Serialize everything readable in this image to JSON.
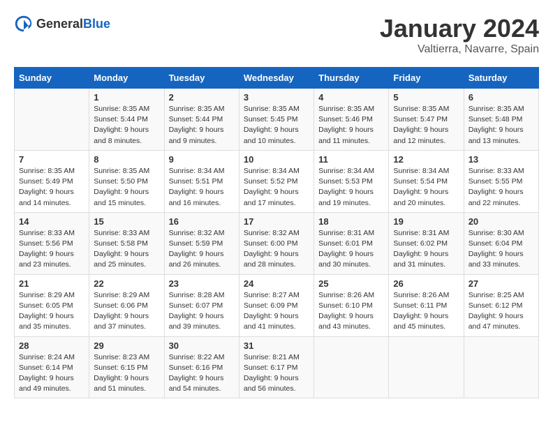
{
  "header": {
    "logo_general": "General",
    "logo_blue": "Blue",
    "month": "January 2024",
    "location": "Valtierra, Navarre, Spain"
  },
  "weekdays": [
    "Sunday",
    "Monday",
    "Tuesday",
    "Wednesday",
    "Thursday",
    "Friday",
    "Saturday"
  ],
  "weeks": [
    [
      {
        "day": "",
        "sunrise": "",
        "sunset": "",
        "daylight": ""
      },
      {
        "day": "1",
        "sunrise": "Sunrise: 8:35 AM",
        "sunset": "Sunset: 5:44 PM",
        "daylight": "Daylight: 9 hours and 8 minutes."
      },
      {
        "day": "2",
        "sunrise": "Sunrise: 8:35 AM",
        "sunset": "Sunset: 5:44 PM",
        "daylight": "Daylight: 9 hours and 9 minutes."
      },
      {
        "day": "3",
        "sunrise": "Sunrise: 8:35 AM",
        "sunset": "Sunset: 5:45 PM",
        "daylight": "Daylight: 9 hours and 10 minutes."
      },
      {
        "day": "4",
        "sunrise": "Sunrise: 8:35 AM",
        "sunset": "Sunset: 5:46 PM",
        "daylight": "Daylight: 9 hours and 11 minutes."
      },
      {
        "day": "5",
        "sunrise": "Sunrise: 8:35 AM",
        "sunset": "Sunset: 5:47 PM",
        "daylight": "Daylight: 9 hours and 12 minutes."
      },
      {
        "day": "6",
        "sunrise": "Sunrise: 8:35 AM",
        "sunset": "Sunset: 5:48 PM",
        "daylight": "Daylight: 9 hours and 13 minutes."
      }
    ],
    [
      {
        "day": "7",
        "sunrise": "Sunrise: 8:35 AM",
        "sunset": "Sunset: 5:49 PM",
        "daylight": "Daylight: 9 hours and 14 minutes."
      },
      {
        "day": "8",
        "sunrise": "Sunrise: 8:35 AM",
        "sunset": "Sunset: 5:50 PM",
        "daylight": "Daylight: 9 hours and 15 minutes."
      },
      {
        "day": "9",
        "sunrise": "Sunrise: 8:34 AM",
        "sunset": "Sunset: 5:51 PM",
        "daylight": "Daylight: 9 hours and 16 minutes."
      },
      {
        "day": "10",
        "sunrise": "Sunrise: 8:34 AM",
        "sunset": "Sunset: 5:52 PM",
        "daylight": "Daylight: 9 hours and 17 minutes."
      },
      {
        "day": "11",
        "sunrise": "Sunrise: 8:34 AM",
        "sunset": "Sunset: 5:53 PM",
        "daylight": "Daylight: 9 hours and 19 minutes."
      },
      {
        "day": "12",
        "sunrise": "Sunrise: 8:34 AM",
        "sunset": "Sunset: 5:54 PM",
        "daylight": "Daylight: 9 hours and 20 minutes."
      },
      {
        "day": "13",
        "sunrise": "Sunrise: 8:33 AM",
        "sunset": "Sunset: 5:55 PM",
        "daylight": "Daylight: 9 hours and 22 minutes."
      }
    ],
    [
      {
        "day": "14",
        "sunrise": "Sunrise: 8:33 AM",
        "sunset": "Sunset: 5:56 PM",
        "daylight": "Daylight: 9 hours and 23 minutes."
      },
      {
        "day": "15",
        "sunrise": "Sunrise: 8:33 AM",
        "sunset": "Sunset: 5:58 PM",
        "daylight": "Daylight: 9 hours and 25 minutes."
      },
      {
        "day": "16",
        "sunrise": "Sunrise: 8:32 AM",
        "sunset": "Sunset: 5:59 PM",
        "daylight": "Daylight: 9 hours and 26 minutes."
      },
      {
        "day": "17",
        "sunrise": "Sunrise: 8:32 AM",
        "sunset": "Sunset: 6:00 PM",
        "daylight": "Daylight: 9 hours and 28 minutes."
      },
      {
        "day": "18",
        "sunrise": "Sunrise: 8:31 AM",
        "sunset": "Sunset: 6:01 PM",
        "daylight": "Daylight: 9 hours and 30 minutes."
      },
      {
        "day": "19",
        "sunrise": "Sunrise: 8:31 AM",
        "sunset": "Sunset: 6:02 PM",
        "daylight": "Daylight: 9 hours and 31 minutes."
      },
      {
        "day": "20",
        "sunrise": "Sunrise: 8:30 AM",
        "sunset": "Sunset: 6:04 PM",
        "daylight": "Daylight: 9 hours and 33 minutes."
      }
    ],
    [
      {
        "day": "21",
        "sunrise": "Sunrise: 8:29 AM",
        "sunset": "Sunset: 6:05 PM",
        "daylight": "Daylight: 9 hours and 35 minutes."
      },
      {
        "day": "22",
        "sunrise": "Sunrise: 8:29 AM",
        "sunset": "Sunset: 6:06 PM",
        "daylight": "Daylight: 9 hours and 37 minutes."
      },
      {
        "day": "23",
        "sunrise": "Sunrise: 8:28 AM",
        "sunset": "Sunset: 6:07 PM",
        "daylight": "Daylight: 9 hours and 39 minutes."
      },
      {
        "day": "24",
        "sunrise": "Sunrise: 8:27 AM",
        "sunset": "Sunset: 6:09 PM",
        "daylight": "Daylight: 9 hours and 41 minutes."
      },
      {
        "day": "25",
        "sunrise": "Sunrise: 8:26 AM",
        "sunset": "Sunset: 6:10 PM",
        "daylight": "Daylight: 9 hours and 43 minutes."
      },
      {
        "day": "26",
        "sunrise": "Sunrise: 8:26 AM",
        "sunset": "Sunset: 6:11 PM",
        "daylight": "Daylight: 9 hours and 45 minutes."
      },
      {
        "day": "27",
        "sunrise": "Sunrise: 8:25 AM",
        "sunset": "Sunset: 6:12 PM",
        "daylight": "Daylight: 9 hours and 47 minutes."
      }
    ],
    [
      {
        "day": "28",
        "sunrise": "Sunrise: 8:24 AM",
        "sunset": "Sunset: 6:14 PM",
        "daylight": "Daylight: 9 hours and 49 minutes."
      },
      {
        "day": "29",
        "sunrise": "Sunrise: 8:23 AM",
        "sunset": "Sunset: 6:15 PM",
        "daylight": "Daylight: 9 hours and 51 minutes."
      },
      {
        "day": "30",
        "sunrise": "Sunrise: 8:22 AM",
        "sunset": "Sunset: 6:16 PM",
        "daylight": "Daylight: 9 hours and 54 minutes."
      },
      {
        "day": "31",
        "sunrise": "Sunrise: 8:21 AM",
        "sunset": "Sunset: 6:17 PM",
        "daylight": "Daylight: 9 hours and 56 minutes."
      },
      {
        "day": "",
        "sunrise": "",
        "sunset": "",
        "daylight": ""
      },
      {
        "day": "",
        "sunrise": "",
        "sunset": "",
        "daylight": ""
      },
      {
        "day": "",
        "sunrise": "",
        "sunset": "",
        "daylight": ""
      }
    ]
  ]
}
